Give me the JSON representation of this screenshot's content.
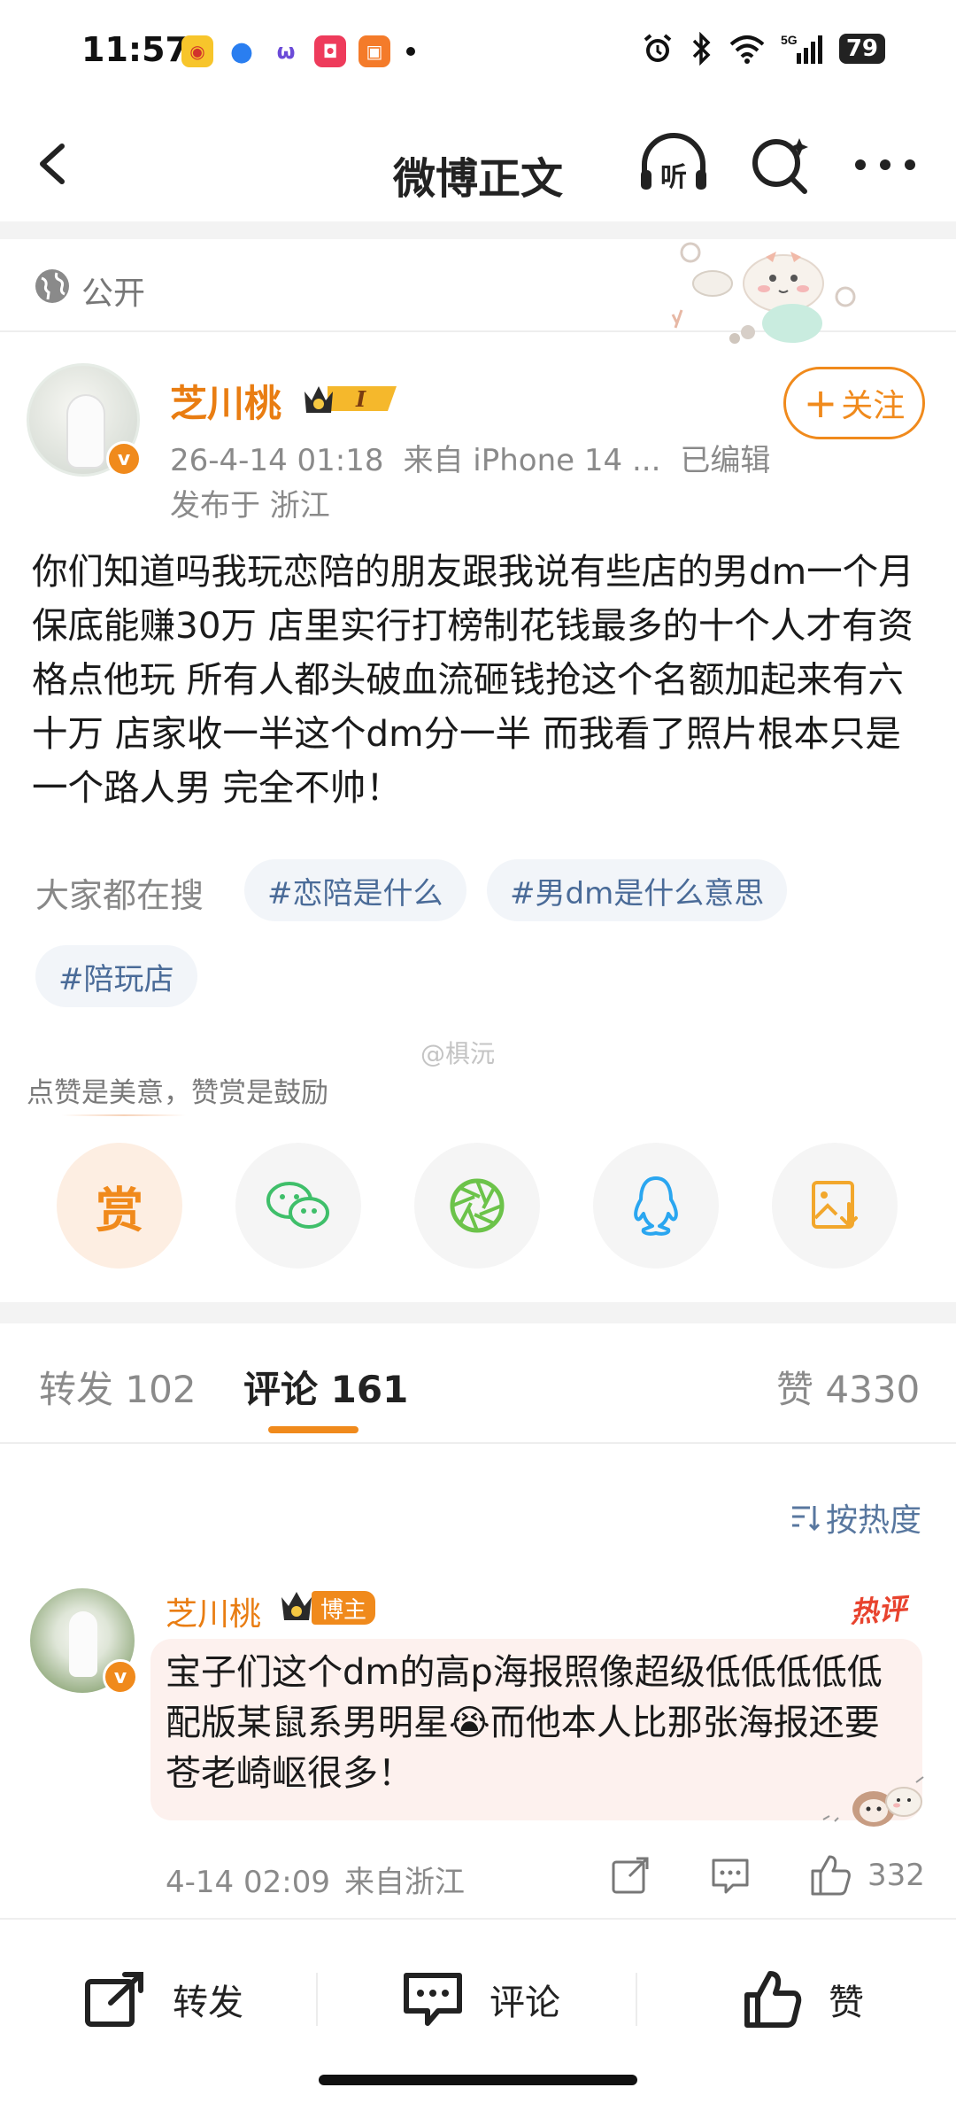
{
  "status_bar": {
    "time": "11:57",
    "battery": "79",
    "network": "5G",
    "icons": [
      "weibo-app-icon",
      "browser-app-icon",
      "app-icon",
      "app-icon",
      "app-icon",
      "alarm-icon",
      "bluetooth-icon",
      "wifi-icon",
      "signal-icon"
    ]
  },
  "nav": {
    "title": "微博正文",
    "listen_label": "听"
  },
  "post": {
    "visibility": "公开",
    "author": "芝川桃",
    "meta": {
      "date": "26-4-14 01:18",
      "source": "来自 iPhone 14 ...",
      "edited": "已编辑"
    },
    "location": "发布于 浙江",
    "follow_label": "关注",
    "text": "你们知道吗我玩恋陪的朋友跟我说有些店的男dm一个月保底能赚30万 店里实行打榜制花钱最多的十个人才有资格点他玩 所有人都头破血流砸钱抢这个名额加起来有六十万 店家收一半这个dm分一半 而我看了照片根本只是一个路人男 完全不帅！",
    "hot_search_label": "大家都在搜",
    "tags": [
      "#恋陪是什么",
      "#男dm是什么意思",
      "#陪玩店"
    ],
    "watermark": "@椇沅",
    "reward_hint": "点赞是美意，赞赏是鼓励",
    "reward_label": "赏"
  },
  "tabs": {
    "repost": {
      "label": "转发",
      "count": "102"
    },
    "comment": {
      "label": "评论",
      "count": "161"
    },
    "like": {
      "label": "赞",
      "count": "4330"
    }
  },
  "sort_label": "按热度",
  "comment": {
    "author": "芝川桃",
    "owner_badge": "博主",
    "hot_label": "热评",
    "text": "宝子们这个dm的高p海报照像超级低低低低低配版某鼠系男明星😭而他本人比那张海报还要苍老崎岖很多！",
    "date": "4-14 02:09",
    "location": "来自浙江",
    "like_count": "332"
  },
  "bottom_bar": {
    "repost": "转发",
    "comment": "评论",
    "like": "赞"
  },
  "colors": {
    "accent": "#f08a1c",
    "tag_text": "#4a6b98",
    "hot": "#e8432e"
  }
}
